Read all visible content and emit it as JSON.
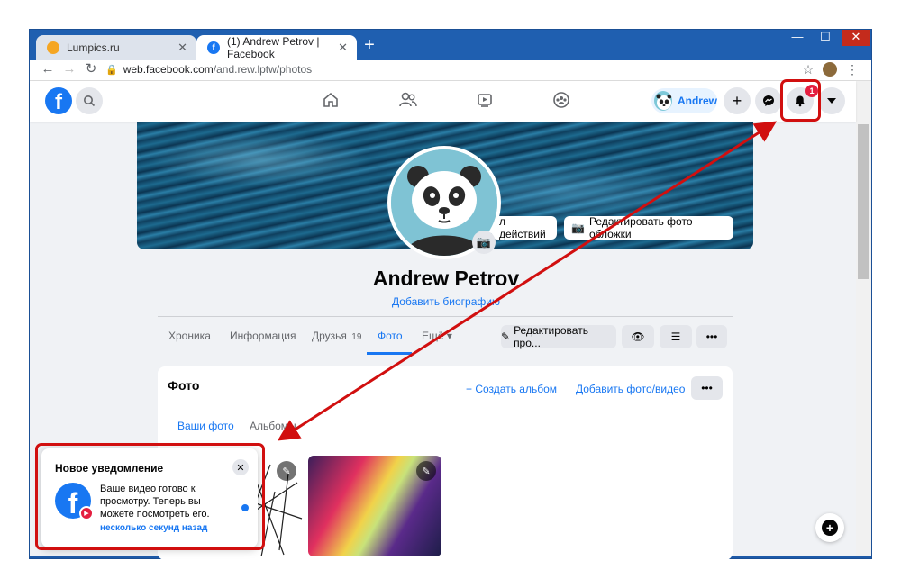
{
  "browser": {
    "tabs": [
      {
        "label": "Lumpics.ru"
      },
      {
        "label": "(1) Andrew Petrov | Facebook"
      }
    ],
    "new_tab": "+",
    "url_domain": "web.facebook.com",
    "url_path": "/and.rew.lptw/photos",
    "controls": {
      "minimize": "—",
      "maximize": "☐",
      "close": "✕"
    },
    "nav": {
      "back": "←",
      "forward": "→",
      "reload": "↻"
    }
  },
  "facebook": {
    "logo": "f",
    "profile_chip": "Andrew",
    "notification_count": "1",
    "cover": {
      "actions_label": "л действий",
      "edit_cover_label": "Редактировать фото обложки"
    },
    "profile_name": "Andrew Petrov",
    "bio_link": "Добавить биографию",
    "tabs": [
      {
        "label": "Хроника"
      },
      {
        "label": "Информация"
      },
      {
        "label": "Друзья",
        "count": "19"
      },
      {
        "label": "Фото"
      },
      {
        "label": "Ещё ▾"
      }
    ],
    "edit_profile_label": "Редактировать про...",
    "photos": {
      "title": "Фото",
      "create_album": "+ Создать альбом",
      "add_photo": "Добавить фото/видео",
      "subtabs": [
        {
          "label": "Ваши фото"
        },
        {
          "label": "Альбомы"
        }
      ]
    }
  },
  "notification": {
    "title": "Новое уведомление",
    "text": "Ваше видео готово к просмотру. Теперь вы можете посмотреть его.",
    "time": "несколько секунд назад"
  },
  "colors": {
    "accent": "#1877f2",
    "annotation": "#d10f0f"
  }
}
